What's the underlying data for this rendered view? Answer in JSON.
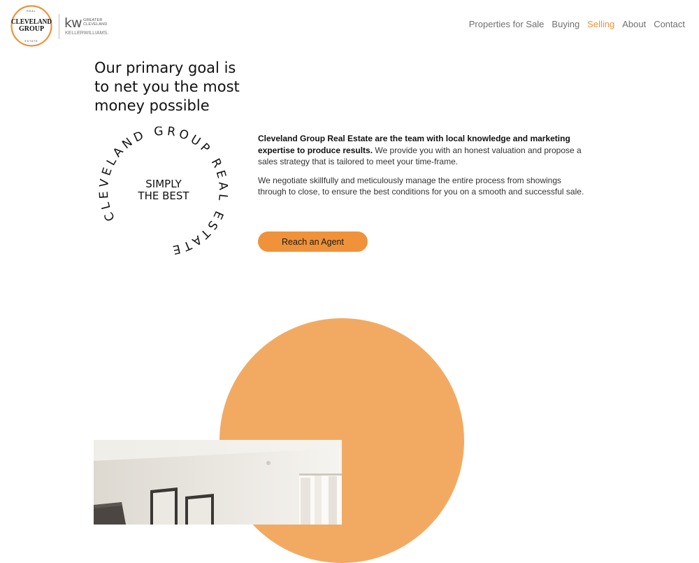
{
  "logo": {
    "real": "REAL",
    "line1": "CLEVELAND",
    "line2": "GROUP",
    "estate": "ESTATE",
    "accent_color": "#f0923a"
  },
  "partner_logo": {
    "mark": "kw",
    "greater_line1": "GREATER",
    "greater_line2": "CLEVELAND",
    "keller": "KELLERWILLIAMS."
  },
  "nav": {
    "items": [
      {
        "label": "Properties for Sale",
        "active": false
      },
      {
        "label": "Buying",
        "active": false
      },
      {
        "label": "Selling",
        "active": true
      },
      {
        "label": "About",
        "active": false
      },
      {
        "label": "Contact",
        "active": false
      }
    ],
    "active_color": "#f0923a"
  },
  "hero": {
    "headline_lines": [
      "Our primary goal is",
      "to net you the most",
      "money possible"
    ]
  },
  "badge": {
    "ring_text": "CLEVELAND GROUP REAL ESTATE",
    "center_line1": "SIMPLY",
    "center_line2": "THE BEST"
  },
  "body": {
    "p1_strong": "Cleveland Group Real Estate are the team with local knowledge and marketing expertise to produce results.",
    "p1_rest": " We provide  you with an honest valuation and propose a sales strategy that is tailored to meet your time-frame.",
    "p2": "We negotiate skillfully and meticulously manage the entire process from showings through to close, to ensure the best conditions for you on a smooth and successful sale."
  },
  "cta": {
    "label": "Reach an Agent",
    "color": "#f0923a"
  },
  "decor": {
    "circle_color": "#f2aa62"
  }
}
